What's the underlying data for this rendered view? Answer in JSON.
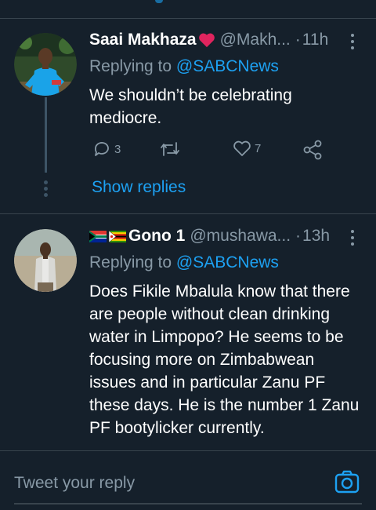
{
  "colors": {
    "background": "#15202b",
    "accent": "#1da1f2",
    "secondary_text": "#8899a6",
    "divider": "#38444d",
    "heart": "#e0245e"
  },
  "tweets": [
    {
      "name": "Saai Makhaza",
      "name_emoji": "red-heart",
      "handle": "@Makh...",
      "separator": "·",
      "time": "11h",
      "replying_prefix": "Replying to",
      "replying_to": "@SABCNews",
      "text": "We shouldn’t be celebrating mediocre.",
      "reply_count": "3",
      "retweet_count": "",
      "like_count": "7",
      "show_replies_label": "Show replies"
    },
    {
      "name": "Gono 1",
      "name_emoji": "south-africa-flag zimbabwe-flag",
      "handle": "@mushawa...",
      "separator": "·",
      "time": "13h",
      "replying_prefix": "Replying to",
      "replying_to": "@SABCNews",
      "text": "Does Fikile Mbalula know that there are people without clean drinking water in Limpopo? He seems to be focusing more on Zimbabwean issues and in particular Zanu PF these days. He is the number 1 Zanu PF bootylicker currently."
    }
  ],
  "composer": {
    "placeholder": "Tweet your reply",
    "camera_icon": "camera-icon"
  }
}
